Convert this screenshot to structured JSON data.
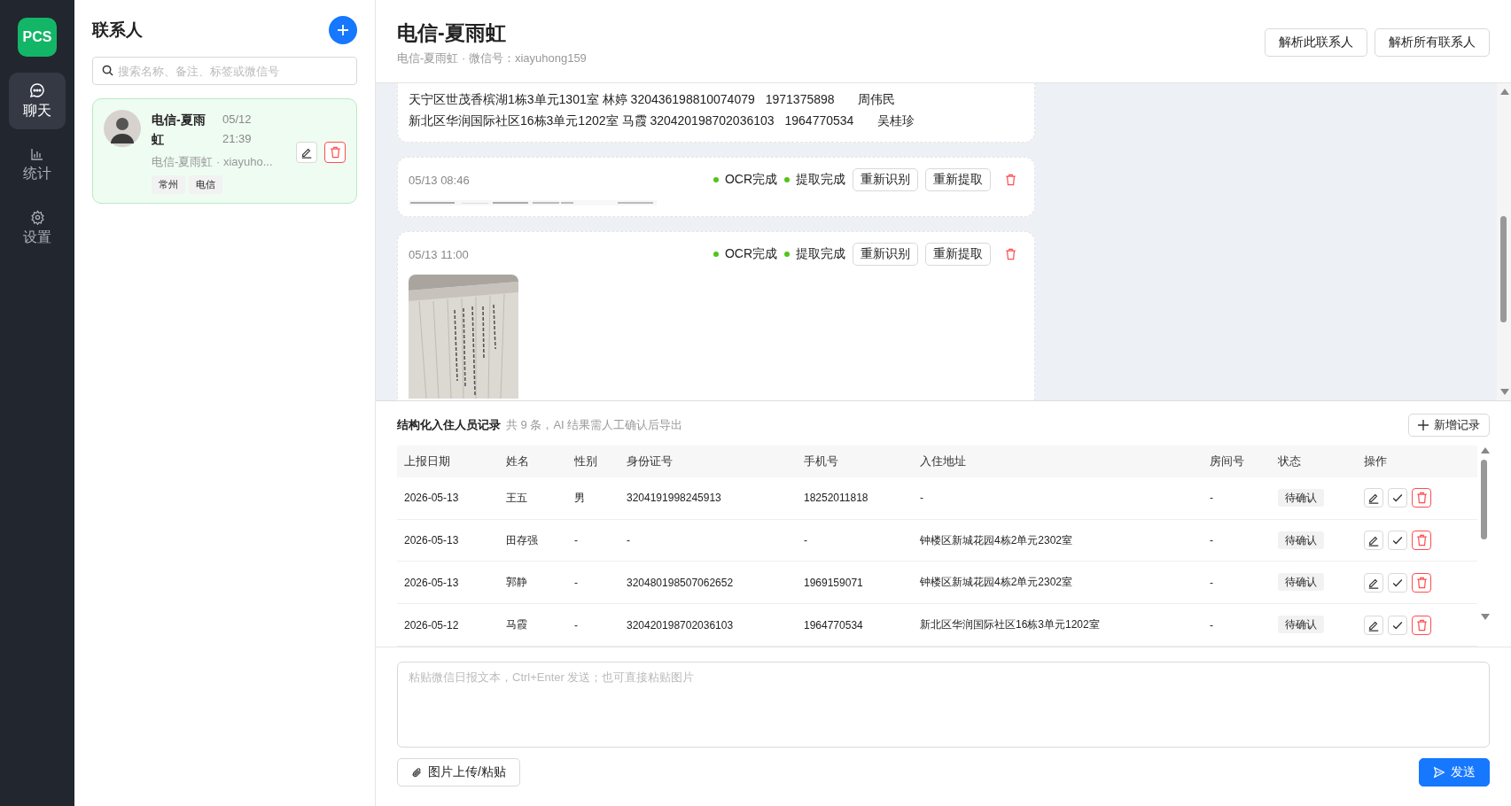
{
  "sidebar": {
    "logo": "PCS",
    "items": [
      {
        "label": "聊天",
        "selected": true
      },
      {
        "label": "统计",
        "selected": false
      },
      {
        "label": "设置",
        "selected": false
      }
    ]
  },
  "contacts": {
    "title": "联系人",
    "search": {
      "placeholder": "搜索名称、备注、标签或微信号"
    },
    "items": [
      {
        "name": "电信-夏雨虹",
        "time": "05/12 21:39",
        "subtitle": "电信-夏雨虹 · xiayuho...",
        "tags": [
          "常州",
          "电信"
        ],
        "selected": true
      }
    ]
  },
  "chat": {
    "title": "电信-夏雨虹",
    "subtitle": "电信-夏雨虹 · 微信号：xiayuhong159",
    "actions": [
      "解析此联系人",
      "解析所有联系人"
    ],
    "messages": [
      {
        "kind": "text",
        "lines": [
          [
            "天宁区世茂香槟湖1栋3单元1301室",
            "林婷 320436198810074079",
            "1971375898",
            "周伟民"
          ],
          [
            "新北区华润国际社区16栋3单元1202室",
            "马霞 320420198702036103",
            "1964770534",
            "吴桂珍"
          ]
        ]
      },
      {
        "kind": "strip",
        "time": "05/13 08:46",
        "statuses": [
          {
            "label": "OCR完成",
            "done": true
          },
          {
            "label": "提取完成",
            "done": true
          }
        ],
        "buttons": [
          "重新识别",
          "重新提取"
        ]
      },
      {
        "time": "05/13 11:00",
        "statuses": [
          {
            "label": "OCR完成",
            "done": true
          },
          {
            "label": "提取完成",
            "done": true
          }
        ],
        "buttons": [
          "重新识别",
          "重新提取"
        ]
      }
    ]
  },
  "records": {
    "title": "结构化入住人员记录",
    "summary": "共 9 条，AI 结果需人工确认后导出",
    "add_button": "新增记录",
    "columns": [
      "上报日期",
      "姓名",
      "性别",
      "身份证号",
      "手机号",
      "入住地址",
      "房间号",
      "状态",
      "操作"
    ],
    "rows": [
      {
        "cells": [
          "2026-05-13",
          "王五",
          "男",
          "3204191998245913",
          "18252011818",
          "-",
          "-"
        ],
        "status": "待确认"
      },
      {
        "cells": [
          "2026-05-13",
          "田存强",
          "-",
          "-",
          "-",
          "钟楼区新城花园4栋2单元2302室",
          "-"
        ],
        "status": "待确认"
      },
      {
        "cells": [
          "2026-05-13",
          "郭静",
          "-",
          "320480198507062652",
          "1969159071",
          "钟楼区新城花园4栋2单元2302室",
          "-"
        ],
        "status": "待确认"
      },
      {
        "cells": [
          "2026-05-12",
          "马霞",
          "-",
          "320420198702036103",
          "1964770534",
          "新北区华润国际社区16栋3单元1202室",
          "-"
        ],
        "status": "待确认"
      }
    ]
  },
  "composer": {
    "placeholder": "粘贴微信日报文本，Ctrl+Enter 发送；也可直接粘贴图片",
    "upload_button": "图片上传/粘贴",
    "send_button": "发送"
  }
}
